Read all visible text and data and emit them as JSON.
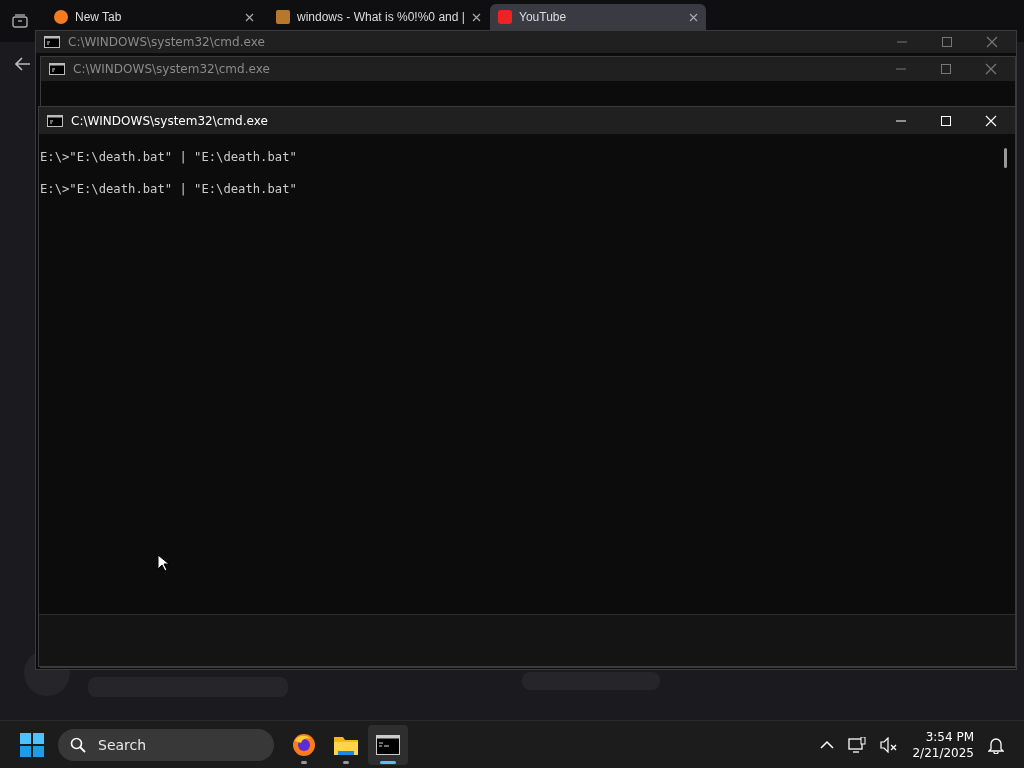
{
  "browser": {
    "tabs": [
      {
        "title": "New Tab",
        "kind": "browser",
        "selected": false
      },
      {
        "title": "windows - What is %0!%0 and |",
        "kind": "forum",
        "selected": false
      },
      {
        "title": "YouTube",
        "kind": "video",
        "selected": true
      }
    ]
  },
  "windows": [
    {
      "title": "C:\\WINDOWS\\system32\\cmd.exe",
      "active": false
    },
    {
      "title": "C:\\WINDOWS\\system32\\cmd.exe",
      "active": false
    },
    {
      "title": "C:\\WINDOWS\\system32\\cmd.exe",
      "active": true,
      "lines": [
        "E:\\>\"E:\\death.bat\" | \"E:\\death.bat\"",
        "E:\\>\"E:\\death.bat\" | \"E:\\death.bat\""
      ]
    }
  ],
  "taskbar": {
    "search": {
      "placeholder": "Search"
    },
    "apps": [
      {
        "kind": "firefox",
        "selected": false
      },
      {
        "kind": "folder",
        "selected": false
      },
      {
        "kind": "terminal",
        "selected": true
      }
    ],
    "time": "3:54 PM",
    "date": "2/21/2025"
  }
}
